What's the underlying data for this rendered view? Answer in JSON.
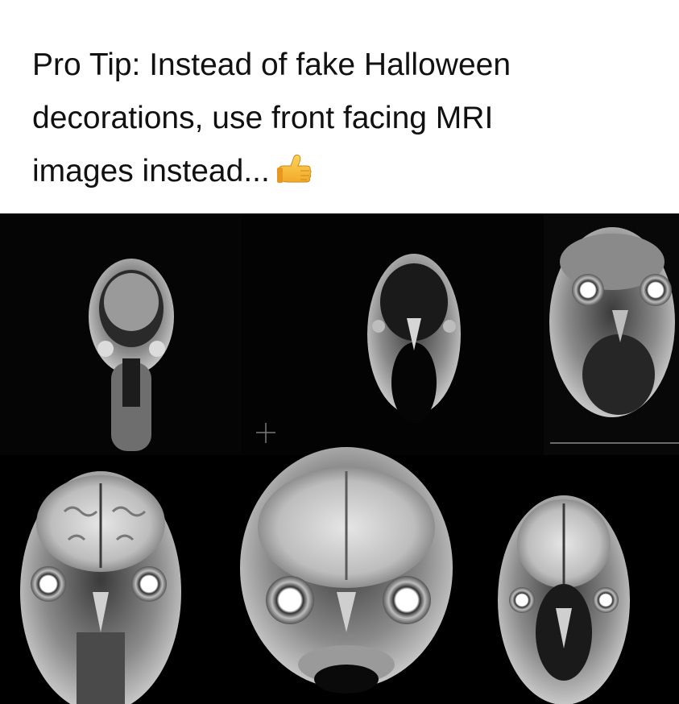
{
  "caption": {
    "line1": "Pro Tip: Instead of fake Halloween",
    "line2": "decorations, use front facing MRI",
    "line3": "images instead...",
    "emoji": "thumbs-up-icon"
  },
  "image": {
    "subject": "grid of front facing MRI head scans",
    "background": "#000000",
    "scans": [
      "scan-1",
      "scan-2",
      "scan-3",
      "scan-4",
      "scan-5",
      "scan-6"
    ]
  }
}
